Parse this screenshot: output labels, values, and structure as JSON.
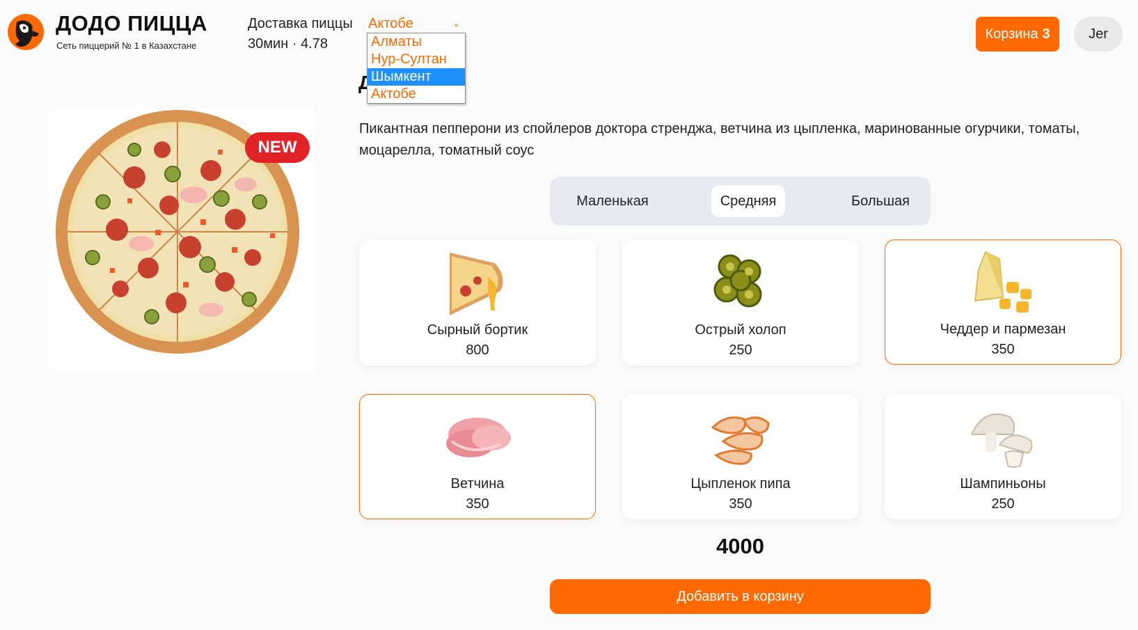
{
  "header": {
    "brand_title": "ДОДО ПИЦЦА",
    "brand_subtitle": "Сеть пиццерий № 1 в Казахстане",
    "delivery_label": "Доставка пиццы",
    "selected_city": "Актобе",
    "meta": "30мин · 4.78",
    "cart_label": "Корзина",
    "cart_count": "3",
    "user_label": "Jer"
  },
  "city_dropdown": {
    "options": [
      "Алматы",
      "Нур-Султан",
      "Шымкент",
      "Актобе"
    ],
    "highlighted": "Шымкент"
  },
  "product": {
    "title_visible": "Д",
    "badge": "NEW",
    "description": "Пикантная пепперони из спойлеров доктора стренджа, ветчина из цыпленка, маринованные огурчики, томаты, моцарелла, томатный соус"
  },
  "sizes": {
    "options": [
      "Маленькая",
      "Средняя",
      "Большая"
    ],
    "selected": "Средняя"
  },
  "toppings": [
    {
      "name": "Сырный бортик",
      "price": "800",
      "selected": false,
      "icon": "cheese-crust-icon"
    },
    {
      "name": "Острый холоп",
      "price": "250",
      "selected": false,
      "icon": "jalapeno-icon"
    },
    {
      "name": "Чеддер и пармезан",
      "price": "350",
      "selected": true,
      "icon": "cheese-icon"
    },
    {
      "name": "Ветчина",
      "price": "350",
      "selected": true,
      "icon": "ham-icon"
    },
    {
      "name": "Цыпленок пипа",
      "price": "350",
      "selected": false,
      "icon": "chicken-icon"
    },
    {
      "name": "Шампиньоны",
      "price": "250",
      "selected": false,
      "icon": "mushroom-icon"
    }
  ],
  "total": "4000",
  "add_to_cart_label": "Добавить в корзину",
  "colors": {
    "accent": "#ff6900",
    "badge": "#e32227",
    "highlight": "#1e90ff",
    "switch_bg": "#e7ebf1"
  }
}
